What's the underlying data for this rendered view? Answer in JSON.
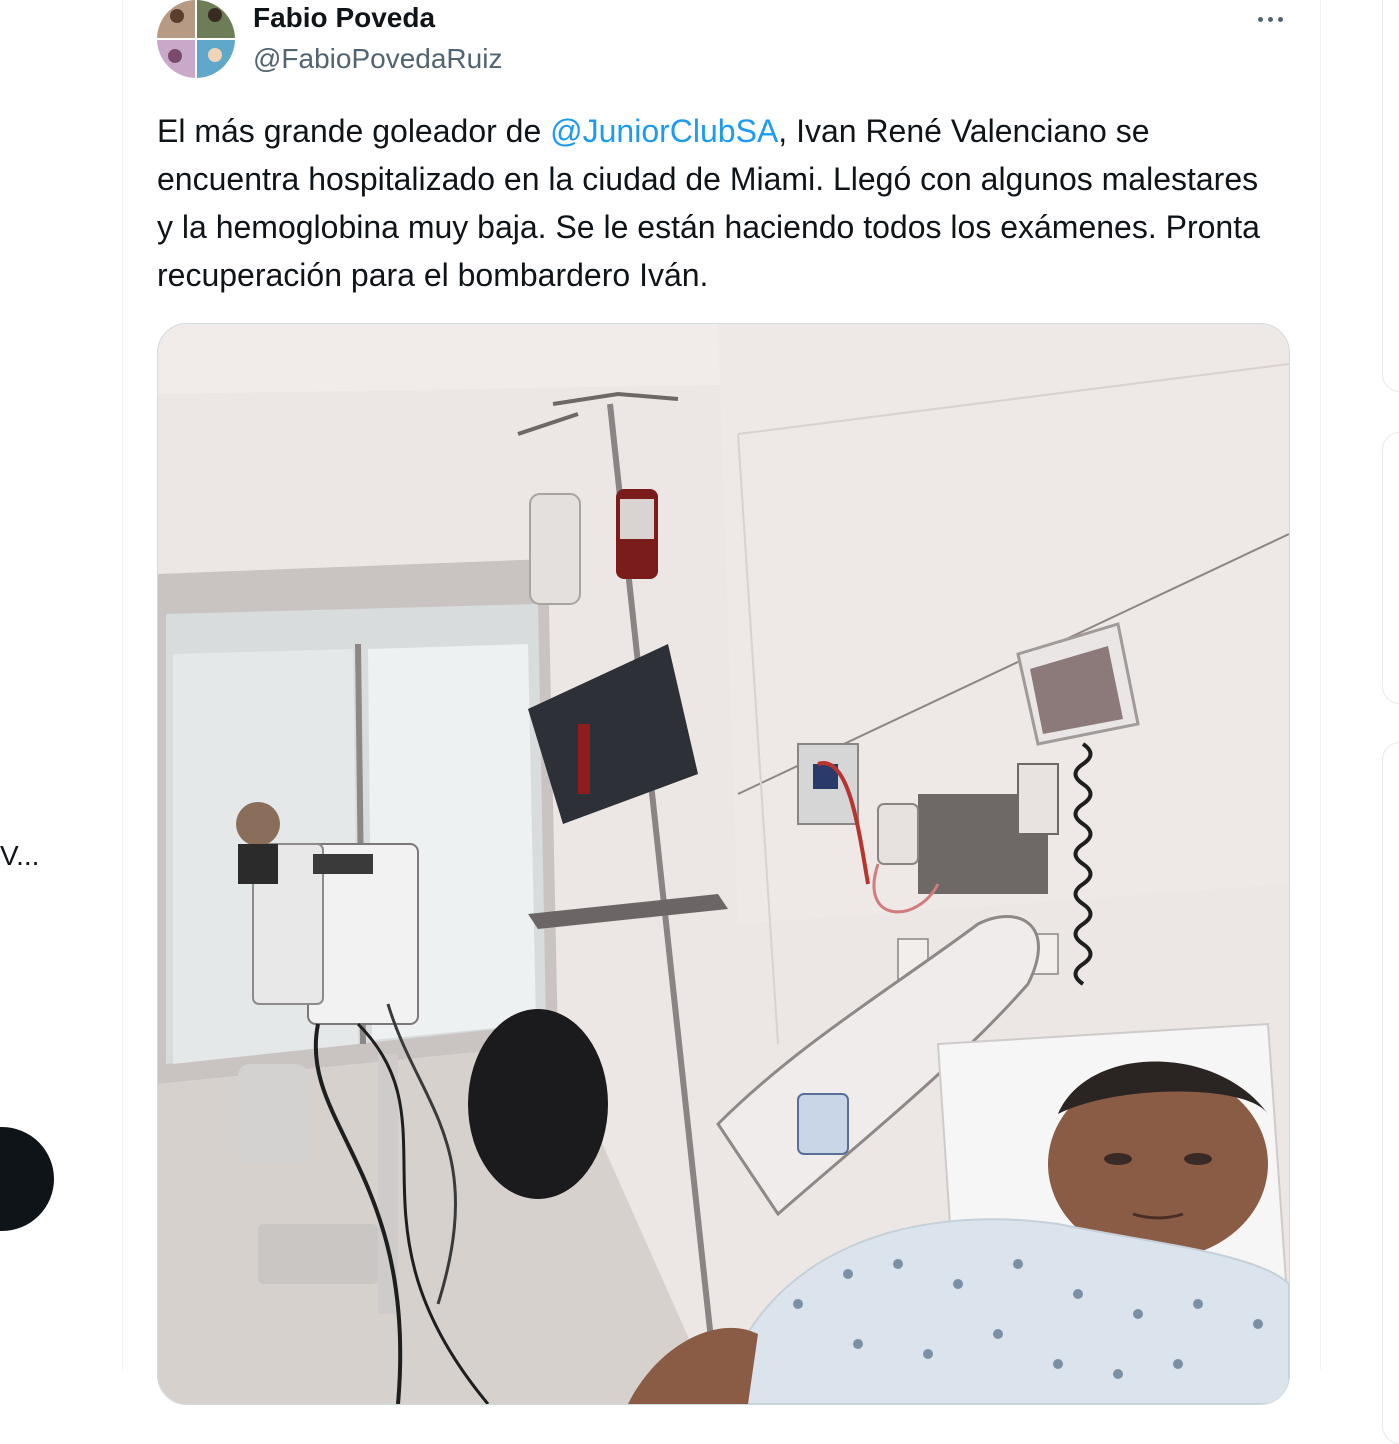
{
  "tweet": {
    "author_name": "Fabio Poveda",
    "author_handle": "@FabioPovedaRuiz",
    "text_before": "El más grande goleador de ",
    "mention": "@JuniorClubSA",
    "text_after": ", Ivan René Valenciano se encuentra hospitalizado en la ciudad de Miami. Llegó con algunos malestares y la hemoglobina muy baja. Se le están haciendo todos los exámenes. Pronta recuperación para el bombardero Iván.",
    "more_icon": "more-horizontal-icon"
  },
  "left_sidebar": {
    "truncated_text": "V..."
  },
  "colors": {
    "text": "#0f1419",
    "secondary": "#536471",
    "link": "#1d9bf0",
    "border": "#eff3f4"
  }
}
